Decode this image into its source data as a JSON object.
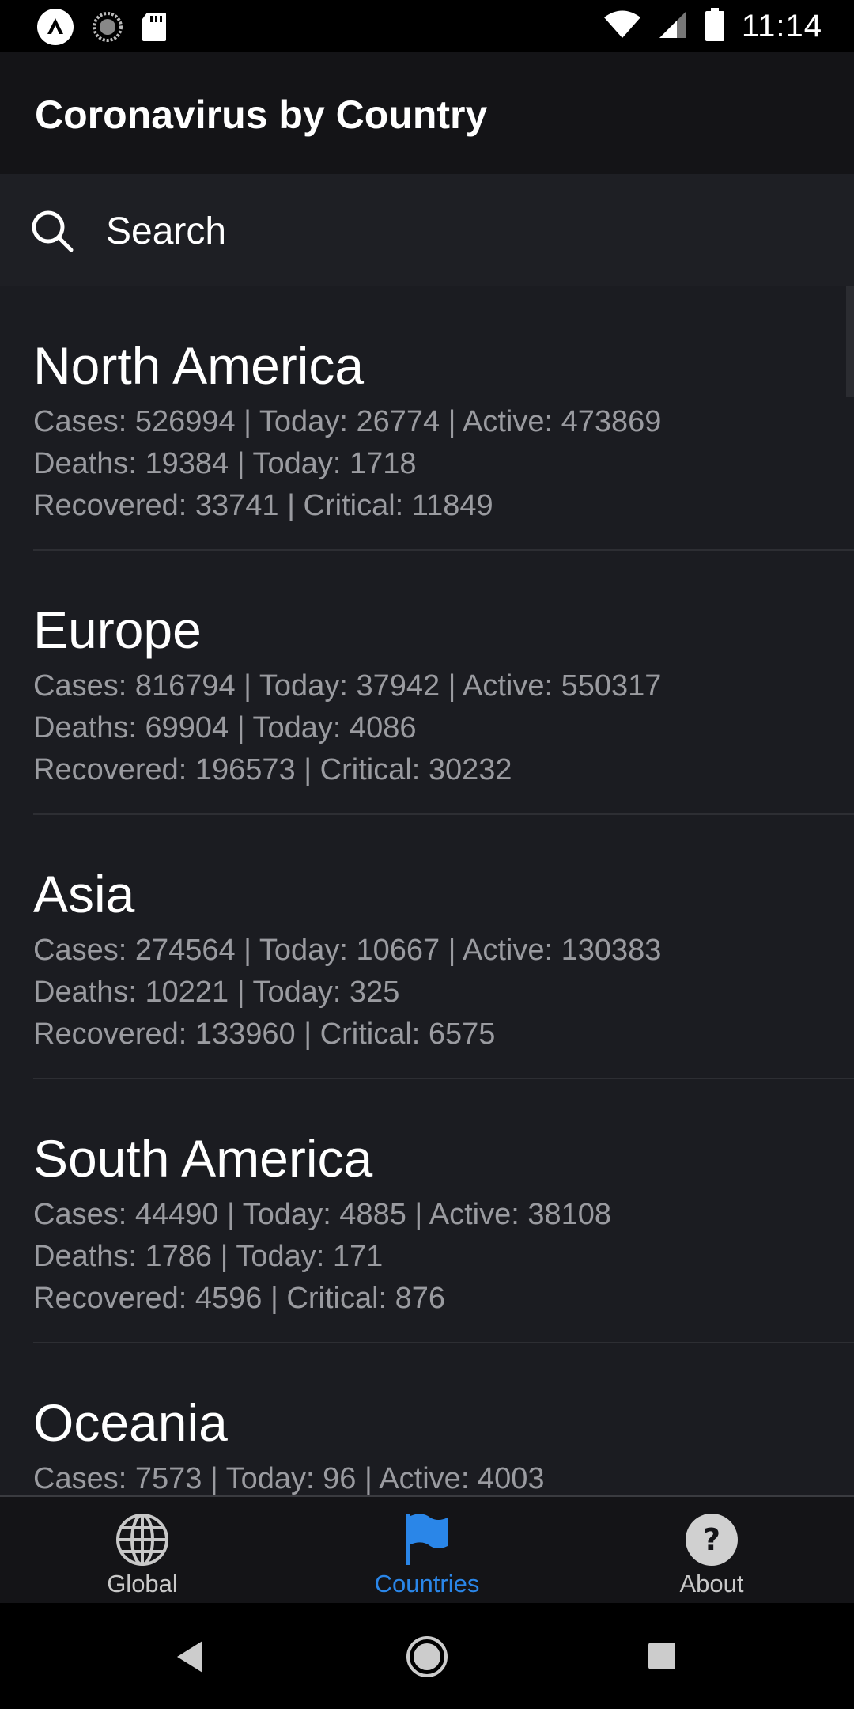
{
  "status_bar": {
    "time": "11:14"
  },
  "app_bar": {
    "title": "Coronavirus by Country"
  },
  "search": {
    "placeholder": "Search"
  },
  "regions": [
    {
      "name": "North America",
      "line1": "Cases: 526994 | Today: 26774 | Active: 473869",
      "line2": "Deaths: 19384 | Today: 1718",
      "line3": "Recovered: 33741 | Critical: 11849"
    },
    {
      "name": "Europe",
      "line1": "Cases: 816794 | Today: 37942 | Active: 550317",
      "line2": "Deaths: 69904 | Today: 4086",
      "line3": "Recovered: 196573 | Critical: 30232"
    },
    {
      "name": "Asia",
      "line1": "Cases: 274564 | Today: 10667 | Active: 130383",
      "line2": "Deaths: 10221 | Today: 325",
      "line3": "Recovered: 133960 | Critical: 6575"
    },
    {
      "name": "South America",
      "line1": "Cases: 44490 | Today: 4885 | Active: 38108",
      "line2": "Deaths: 1786 | Today: 171",
      "line3": "Recovered: 4596 | Critical: 876"
    },
    {
      "name": "Oceania",
      "line1": "Cases: 7573 | Today: 96 | Active: 4003",
      "line2": "",
      "line3": ""
    }
  ],
  "bottom_nav": {
    "items": [
      {
        "label": "Global",
        "icon": "globe-icon",
        "active": false
      },
      {
        "label": "Countries",
        "icon": "flag-icon",
        "active": true
      },
      {
        "label": "About",
        "icon": "help-icon",
        "active": false
      }
    ]
  },
  "colors": {
    "background": "#1b1c21",
    "accent": "#2a86e8",
    "secondary_text": "#9a9ba0"
  }
}
